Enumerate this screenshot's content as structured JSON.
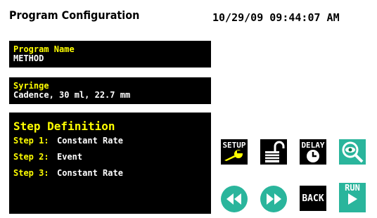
{
  "header": {
    "title": "Program Configuration",
    "datetime": "10/29/09 09:44:07 AM"
  },
  "program": {
    "label": "Program Name",
    "value": "METHOD"
  },
  "syringe": {
    "label": "Syringe",
    "value": "Cadence, 30 ml, 22.7 mm"
  },
  "steps": {
    "heading": "Step Definition",
    "items": [
      {
        "label": "Step 1:",
        "type": "Constant Rate"
      },
      {
        "label": "Step 2:",
        "type": "Event"
      },
      {
        "label": "Step 3:",
        "type": "Constant Rate"
      }
    ]
  },
  "buttons": {
    "setup": "SETUP",
    "delay": "DELAY",
    "back": "BACK",
    "run": "RUN"
  },
  "colors": {
    "accent_yellow": "#ffff00",
    "teal": "#2ab59c",
    "panel": "#000000"
  },
  "icons": {
    "setup": "wrench-icon",
    "lock": "unlock-icon",
    "delay": "clock-icon",
    "view": "magnifier-eye-icon",
    "prev": "rewind-icon",
    "next": "fast-forward-icon",
    "run": "play-icon"
  }
}
